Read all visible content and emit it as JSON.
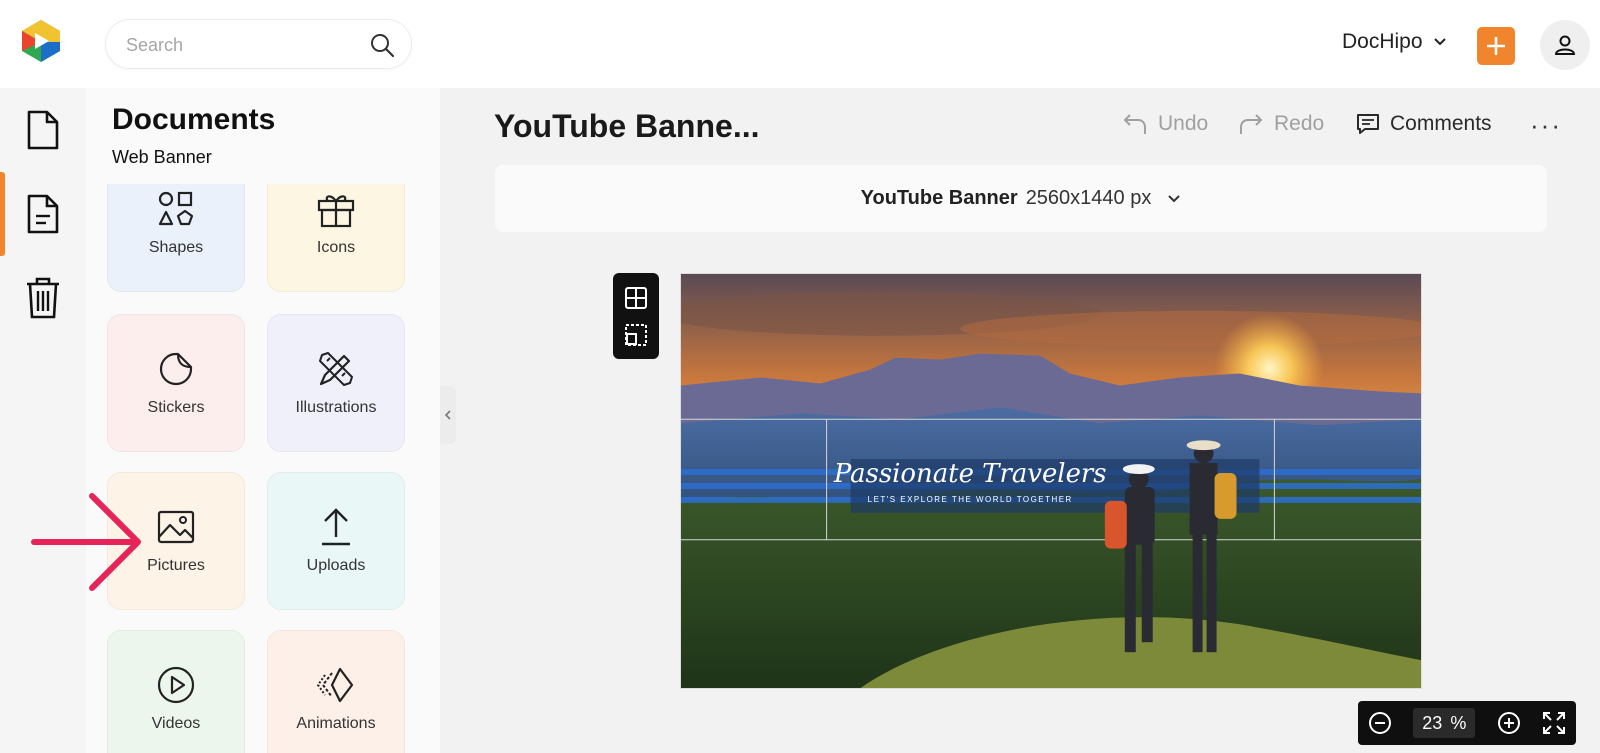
{
  "header": {
    "search_placeholder": "Search",
    "brand": "DocHipo",
    "add_label": "+"
  },
  "rail": {
    "items": [
      {
        "icon": "document-icon"
      },
      {
        "icon": "file-text-icon",
        "active": true
      },
      {
        "icon": "trash-icon"
      }
    ]
  },
  "panel": {
    "title": "Documents",
    "subtitle": "Web Banner",
    "tiles": [
      {
        "label": "Shapes",
        "icon": "shapes-icon",
        "color": "#eaf1fa"
      },
      {
        "label": "Icons",
        "icon": "gift-icon",
        "color": "#fdf6e3"
      },
      {
        "label": "Stickers",
        "icon": "sticker-icon",
        "color": "#fdeeee"
      },
      {
        "label": "Illustrations",
        "icon": "pen-ruler-icon",
        "color": "#f0f0fb"
      },
      {
        "label": "Pictures",
        "icon": "image-icon",
        "color": "#fdf3e6"
      },
      {
        "label": "Uploads",
        "icon": "upload-icon",
        "color": "#e9f7f6"
      },
      {
        "label": "Videos",
        "icon": "play-icon",
        "color": "#edf6ec"
      },
      {
        "label": "Animations",
        "icon": "animation-icon",
        "color": "#fcf0e8"
      }
    ]
  },
  "main": {
    "doc_title": "YouTube Banne...",
    "undo": "Undo",
    "redo": "Redo",
    "comments": "Comments",
    "more": "···",
    "size_name": "YouTube Banner",
    "size_dims": "2560x1440 px"
  },
  "banner": {
    "title": "Passionate Travelers",
    "tagline": "LET'S EXPLORE THE WORLD TOGETHER"
  },
  "zoom": {
    "value": "23",
    "unit": "%"
  },
  "colors": {
    "accent": "#f0852d",
    "annotation_arrow": "#e6245a"
  }
}
